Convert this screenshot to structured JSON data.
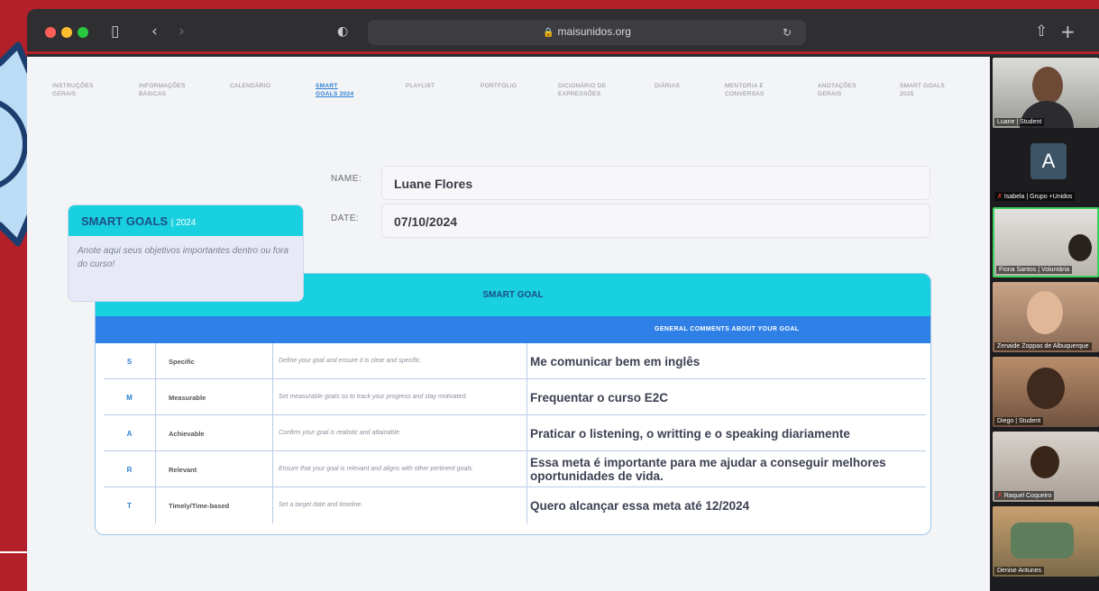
{
  "browser": {
    "url": "maisunidos.org",
    "colors": {
      "accent_red": "#b3202a",
      "cyan": "#19d0e0",
      "blue": "#2f80e6"
    },
    "icons": [
      "sidebar-toggle-icon",
      "back-icon",
      "forward-icon",
      "shield-icon",
      "lock-icon",
      "reload-icon",
      "share-icon",
      "new-tab-icon"
    ]
  },
  "nav": [
    {
      "label": "INSTRUÇÕES GERAIS"
    },
    {
      "label": "INFORMAÇÕES BÁSICAS"
    },
    {
      "label": "CALENDÁRIO"
    },
    {
      "label": "SMART GOALS 2024",
      "active": true
    },
    {
      "label": "PLAYLIST"
    },
    {
      "label": "PORTFÓLIO"
    },
    {
      "label": "DICIONÁRIO DE EXPRESSÕES"
    },
    {
      "label": "DIÁRIAS"
    },
    {
      "label": "MENTORIA E CONVERSAS"
    },
    {
      "label": "ANOTAÇÕES GERAIS"
    },
    {
      "label": "SMART GOALS 2025"
    }
  ],
  "form": {
    "name_label": "NAME:",
    "name_value": "Luane Flores",
    "date_label": "DATE:",
    "date_value": "07/10/2024"
  },
  "card": {
    "title": "SMART GOALS",
    "year": "| 2024",
    "body": "Anote aqui seus objetivos importantes dentro ou fora do curso!"
  },
  "table": {
    "title": "SMART GOAL",
    "comments_header": "GENERAL COMMENTS ABOUT YOUR GOAL",
    "rows": [
      {
        "letter": "S",
        "name": "Specific",
        "desc": "Define your goal and ensure it is clear and specific.",
        "comment": "Me comunicar bem em inglês"
      },
      {
        "letter": "M",
        "name": "Measurable",
        "desc": "Set measurable goals so to track your progress and stay motivated.",
        "comment": "Frequentar o curso E2C"
      },
      {
        "letter": "A",
        "name": "Achievable",
        "desc": "Confirm your goal is realistic and attainable.",
        "comment": "Praticar o listening, o writting e o speaking diariamente"
      },
      {
        "letter": "R",
        "name": "Relevant",
        "desc": "Ensure that your goal is relevant and aligns with other pertinent goals.",
        "comment": "Essa meta é importante para me ajudar a conseguir melhores oportunidades de vida."
      },
      {
        "letter": "T",
        "name": "Timely/Time-based",
        "desc": "Set a target date and timeline.",
        "comment": "Quero alcançar essa meta até 12/2024"
      }
    ]
  },
  "participants": [
    {
      "name": "Luane | Student"
    },
    {
      "name": "Isabela | Grupo +Unidos",
      "initial": "A",
      "muted": true
    },
    {
      "name": "Fiona Santos | Voluntária"
    },
    {
      "name": "Zenaide Zoppas de Albuquerque"
    },
    {
      "name": "Diego | Student"
    },
    {
      "name": "Raquel Coqueiro",
      "muted": true
    },
    {
      "name": "Denise Antunes"
    }
  ]
}
